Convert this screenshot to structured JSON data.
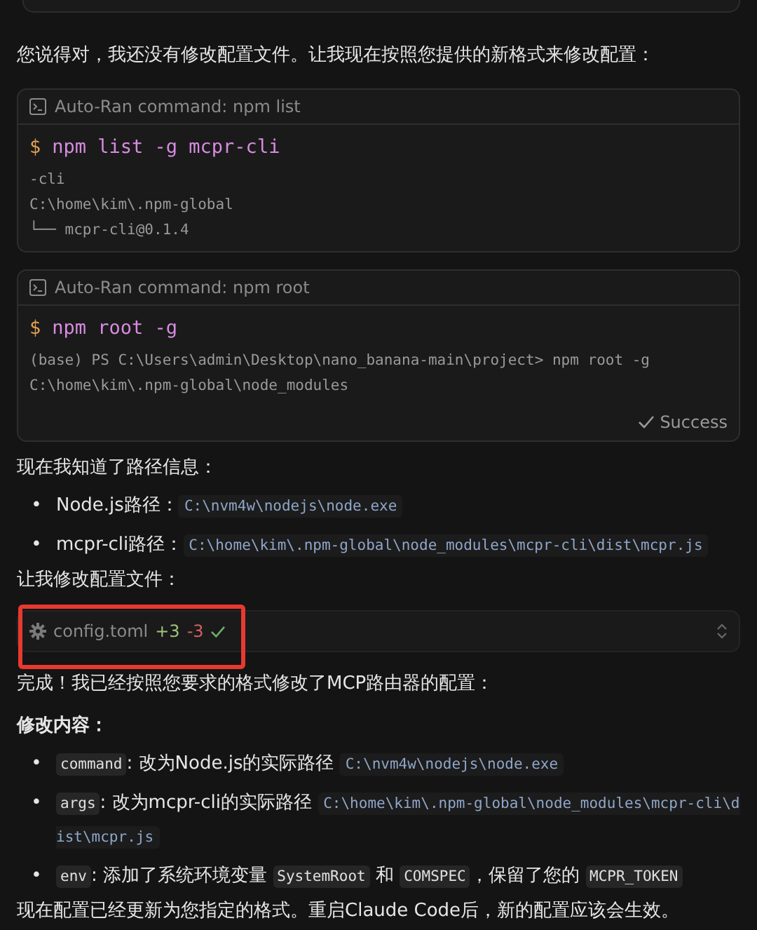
{
  "intro": "您说得对，我还没有修改配置文件。让我现在按照您提供的新格式来修改配置：",
  "commands": [
    {
      "header": "Auto-Ran command: npm list",
      "prompt": "$",
      "command": "npm list -g mcpr-cli",
      "output": [
        "-cli",
        "C:\\home\\kim\\.npm-global",
        "└── mcpr-cli@0.1.4"
      ]
    },
    {
      "header": "Auto-Ran command: npm root",
      "prompt": "$",
      "command": "npm root -g",
      "output": [
        "(base) PS C:\\Users\\admin\\Desktop\\nano_banana-main\\project> npm root -g",
        "C:\\home\\kim\\.npm-global\\node_modules"
      ],
      "status": "Success"
    }
  ],
  "paths_heading": "现在我知道了路径信息：",
  "paths": [
    {
      "bullet": "•",
      "segments": [
        {
          "kind": "text",
          "text": "Node.js路径："
        },
        {
          "kind": "code",
          "text": "C:\\nvm4w\\nodejs\\node.exe"
        }
      ]
    },
    {
      "bullet": "•",
      "segments": [
        {
          "kind": "text",
          "text": "mcpr-cli路径："
        },
        {
          "kind": "code",
          "text": "C:\\home\\kim\\.npm-global\\node_modules\\mcpr-cli\\dist\\mcpr.js"
        }
      ]
    }
  ],
  "edit_heading": "让我修改配置文件：",
  "file_change": {
    "file": "config.toml",
    "added": "+3",
    "removed": "-3",
    "highlighted": true
  },
  "done": "完成！我已经按照您要求的格式修改了MCP路由器的配置：",
  "changes_heading": "修改内容：",
  "changes": [
    {
      "bullet": "•",
      "segments": [
        {
          "kind": "key",
          "text": "command"
        },
        {
          "kind": "text",
          "text": ": 改为Node.js的实际路径 "
        },
        {
          "kind": "code",
          "text": "C:\\nvm4w\\nodejs\\node.exe"
        }
      ]
    },
    {
      "bullet": "•",
      "segments": [
        {
          "kind": "key",
          "text": "args"
        },
        {
          "kind": "text",
          "text": ": 改为mcpr-cli的实际路径 "
        },
        {
          "kind": "code",
          "text": "C:\\home\\kim\\.npm-global\\node_modules\\mcpr-cli\\dist\\mcpr.js"
        }
      ]
    },
    {
      "bullet": "•",
      "segments": [
        {
          "kind": "key",
          "text": "env"
        },
        {
          "kind": "text",
          "text": ": 添加了系统环境变量 "
        },
        {
          "kind": "key",
          "text": "SystemRoot"
        },
        {
          "kind": "text",
          "text": " 和 "
        },
        {
          "kind": "key",
          "text": "COMSPEC"
        },
        {
          "kind": "text",
          "text": "，保留了您的 "
        },
        {
          "kind": "key",
          "text": "MCPR_TOKEN"
        }
      ]
    }
  ],
  "closing": "现在配置已经更新为您指定的格式。重启Claude Code后，新的配置应该会生效。"
}
